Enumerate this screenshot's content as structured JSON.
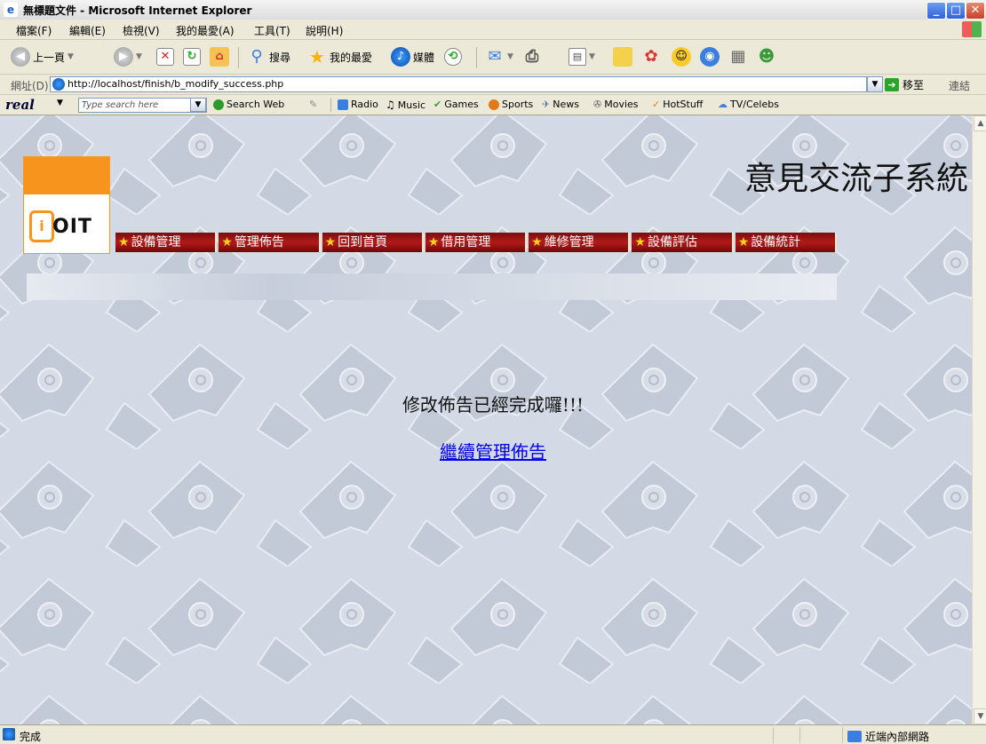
{
  "window": {
    "title": "無標題文件 - Microsoft Internet Explorer",
    "app_icon": "ie-icon"
  },
  "menu": [
    "檔案(F)",
    "編輯(E)",
    "檢視(V)",
    "我的最愛(A)",
    "工具(T)",
    "說明(H)"
  ],
  "toolbar": {
    "back_label": "上一頁",
    "search_label": "搜尋",
    "favorites_label": "我的最愛",
    "media_label": "媒體"
  },
  "address": {
    "label": "網址(D)",
    "url": "http://localhost/finish/b_modify_success.php",
    "go_label": "移至",
    "links_label": "連結"
  },
  "realbar": {
    "brand": "real",
    "search_placeholder": "Type search here",
    "search_web": "Search Web",
    "items": [
      "Radio",
      "Music",
      "Games",
      "Sports",
      "News",
      "Movies",
      "HotStuff",
      "TV/Celebs"
    ]
  },
  "site": {
    "logo_text": "OIT",
    "title": "意見交流子系統",
    "nav": [
      "設備管理",
      "管理佈告",
      "回到首頁",
      "借用管理",
      "維修管理",
      "設備評估",
      "設備統計"
    ],
    "message": "修改佈告已經完成囉!!!",
    "continue_link": "繼續管理佈告"
  },
  "status": {
    "text": "完成",
    "zone": "近端內部網路"
  }
}
